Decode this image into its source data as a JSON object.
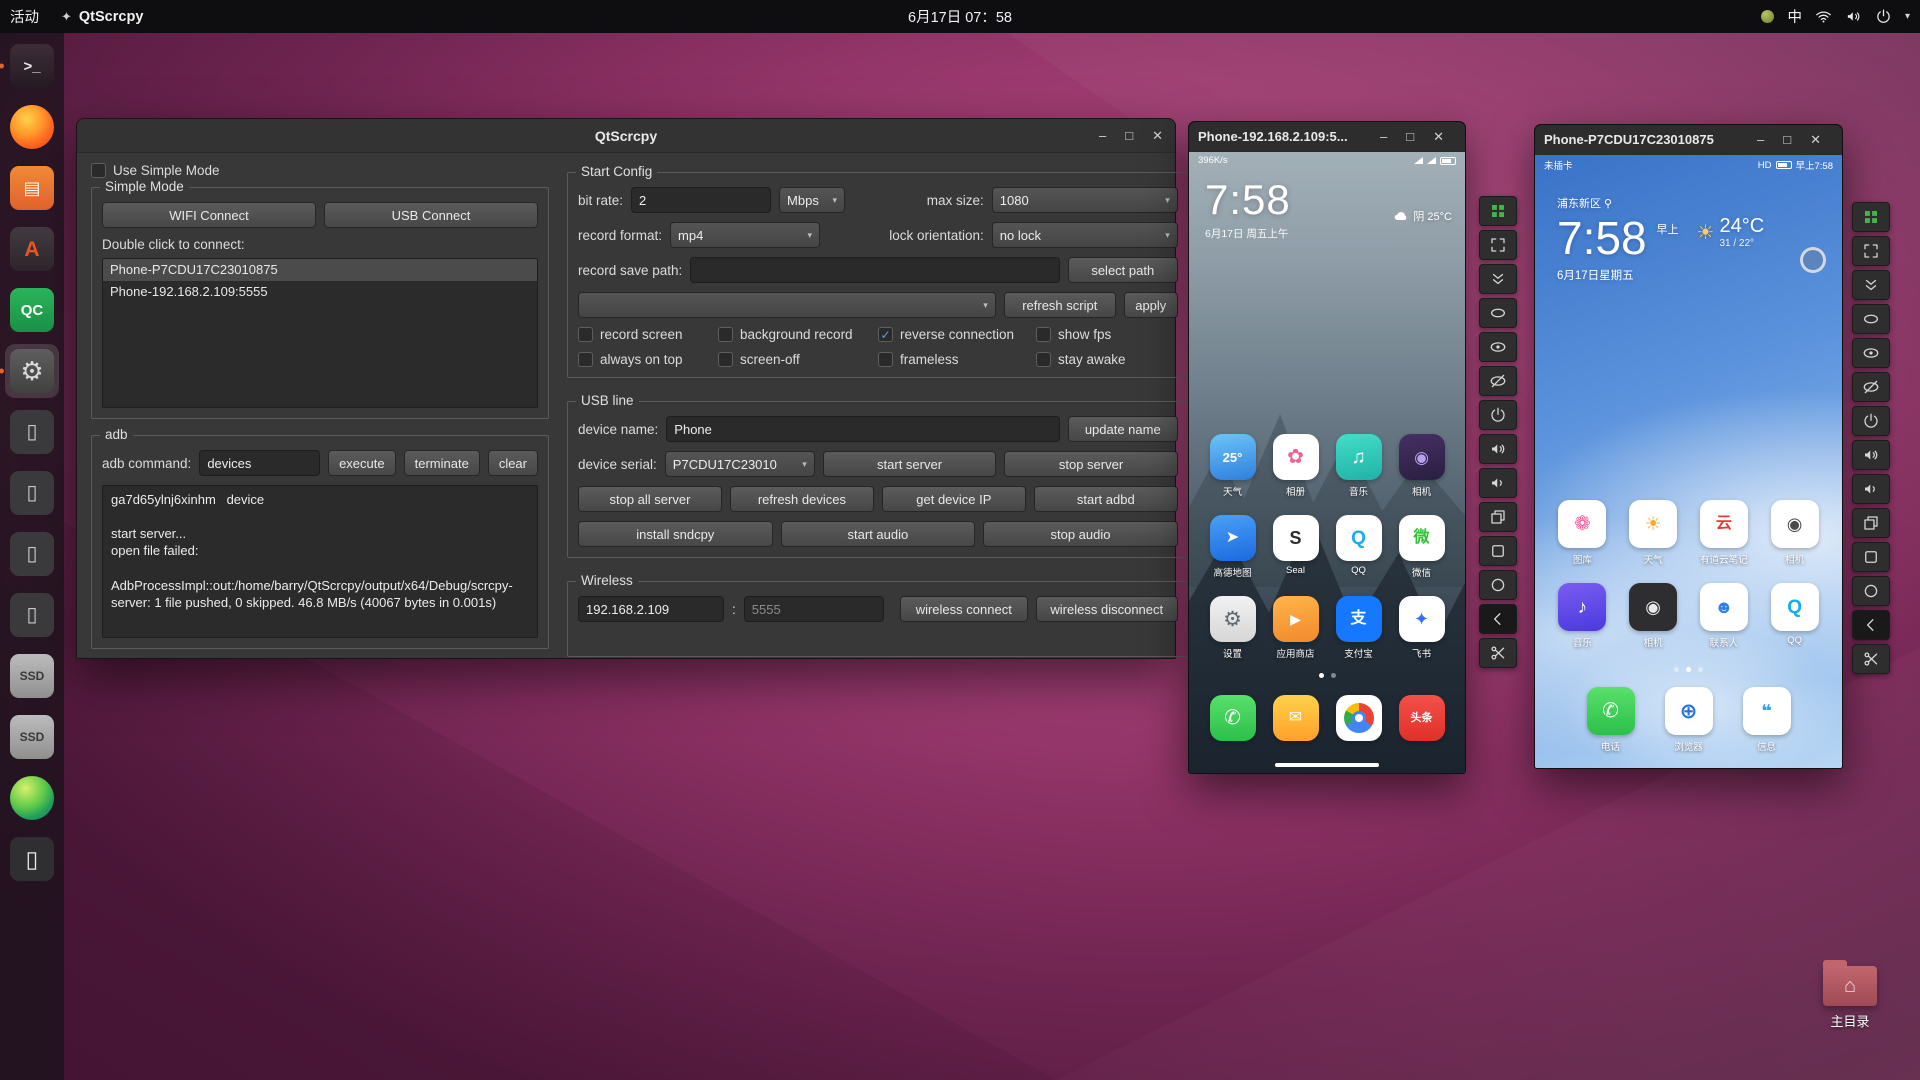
{
  "colors": {
    "accent_check": "#59a0e8",
    "toolbar_screenshot_green": "#44b549",
    "desktop_magenta": "#a84278",
    "running_dot_orange": "#e0622d"
  },
  "topbar": {
    "activities": "活动",
    "app_name": "QtScrcpy",
    "clock": "6月17日 07：58",
    "input_method": "中"
  },
  "dock": {
    "items": [
      {
        "name": "terminal",
        "glyph": ">_",
        "bg": "linear-gradient(#3d2d38,#241a22)",
        "fg": "#e8e6e8",
        "size": 15,
        "running": true
      },
      {
        "name": "firefox",
        "glyph": "",
        "bg": "radial-gradient(circle at 38% 32%, #ffd24a 0%, #ff9a2a 38%, #ff6a1f 62%, #e0431c 100%)",
        "shape": "circle"
      },
      {
        "name": "files",
        "glyph": "▤",
        "bg": "linear-gradient(#f08a38,#e0622a)",
        "fg": "#fff7ee",
        "size": 18
      },
      {
        "name": "ubuntu-software",
        "glyph": "A",
        "bg": "linear-gradient(#423a40,#2c262b)",
        "fg": "#e95420",
        "size": 21
      },
      {
        "name": "qc-app",
        "glyph": "QC",
        "bg": "linear-gradient(#2bb45a,#1a9046)",
        "fg": "#ffffff",
        "size": 15
      },
      {
        "name": "settings-qtscrcpy",
        "glyph": "⚙",
        "bg": "linear-gradient(#5e5e5e,#414141)",
        "fg": "#dadada",
        "size": 26,
        "running": true,
        "active": true
      },
      {
        "name": "device-mirror-1",
        "glyph": "▯",
        "bg": "#3a3a3c",
        "fg": "#c9c9c9",
        "size": 20
      },
      {
        "name": "device-mirror-2",
        "glyph": "▯",
        "bg": "#3a3a3c",
        "fg": "#c9c9c9",
        "size": 20
      },
      {
        "name": "device-mirror-3",
        "glyph": "▯",
        "bg": "#3a3a3c",
        "fg": "#c9c9c9",
        "size": 20
      },
      {
        "name": "device-mirror-4",
        "glyph": "▯",
        "bg": "#3a3a3c",
        "fg": "#c9c9c9",
        "size": 20
      },
      {
        "name": "ssd-drive-1",
        "glyph": "SSD",
        "bg": "linear-gradient(#bcbcbc,#8f8f8f)",
        "fg": "#3a3a3a",
        "size": 12
      },
      {
        "name": "ssd-drive-2",
        "glyph": "SSD",
        "bg": "linear-gradient(#bcbcbc,#8f8f8f)",
        "fg": "#3a3a3a",
        "size": 12
      },
      {
        "name": "green-sphere-app",
        "glyph": "",
        "bg": "radial-gradient(circle at 35% 28%, #d8f06a 0%, #5fc94a 45%, #1f9e5a 70%, #147a86 100%)",
        "shape": "circle"
      },
      {
        "name": "phone-device",
        "glyph": "▯",
        "bg": "#2f2f31",
        "fg": "#e9e9e9",
        "size": 23
      },
      {
        "name": "show-applications",
        "kind": "grid",
        "bg": "transparent"
      }
    ]
  },
  "main": {
    "title": "QtScrcpy",
    "window_buttons": {
      "minimize": "–",
      "maximize": "□",
      "close": "✕"
    },
    "simple": {
      "use_simple_mode": "Use Simple Mode",
      "group_title": "Simple Mode",
      "wifi_connect": "WIFI Connect",
      "usb_connect": "USB Connect",
      "hint": "Double click to connect:",
      "devices": [
        "Phone-P7CDU17C23010875",
        "Phone-192.168.2.109:5555"
      ],
      "selected_index": 0
    },
    "adb": {
      "group_title": "adb",
      "command_label": "adb command:",
      "command_value": "devices",
      "execute": "execute",
      "terminate": "terminate",
      "clear": "clear",
      "log": "ga7d65ylnj6xinhm\tdevice\n\nstart server...\nopen file failed:\n\nAdbProcessImpl::out:/home/barry/QtScrcpy/output/x64/Debug/scrcpy-server: 1 file pushed, 0 skipped. 46.8 MB/s (40067 bytes in 0.001s)"
    },
    "start_config": {
      "title": "Start Config",
      "bit_rate_label": "bit rate:",
      "bit_rate_value": "2",
      "bit_rate_unit": "Mbps",
      "max_size_label": "max size:",
      "max_size_value": "1080",
      "record_format_label": "record format:",
      "record_format_value": "mp4",
      "lock_orientation_label": "lock orientation:",
      "lock_orientation_value": "no lock",
      "record_save_path_label": "record save path:",
      "record_save_path_value": "",
      "select_path": "select path",
      "script_value": "",
      "refresh_script": "refresh script",
      "apply": "apply",
      "checkboxes": [
        {
          "label": "record screen",
          "checked": false
        },
        {
          "label": "background record",
          "checked": false
        },
        {
          "label": "reverse connection",
          "checked": true
        },
        {
          "label": "show fps",
          "checked": false
        },
        {
          "label": "always on top",
          "checked": false
        },
        {
          "label": "screen-off",
          "checked": false
        },
        {
          "label": "frameless",
          "checked": false
        },
        {
          "label": "stay awake",
          "checked": false
        }
      ]
    },
    "usb": {
      "title": "USB line",
      "device_name_label": "device name:",
      "device_name_value": "Phone",
      "update_name": "update name",
      "device_serial_label": "device serial:",
      "device_serial_value": "P7CDU17C23010",
      "buttons_row1": [
        "start server",
        "stop server"
      ],
      "buttons_row2": [
        "stop all server",
        "refresh devices",
        "get device IP",
        "start adbd"
      ],
      "buttons_row3": [
        "install sndcpy",
        "start audio",
        "stop audio"
      ]
    },
    "wireless": {
      "title": "Wireless",
      "ip_value": "192.168.2.109",
      "colon": ":",
      "port_placeholder": "5555",
      "connect": "wireless connect",
      "disconnect": "wireless disconnect"
    }
  },
  "phone1": {
    "window_title": "Phone-192.168.2.109:5...",
    "status_left": "396K/s",
    "clock": "7:58",
    "date": "6月17日 周五上午",
    "weather": "阴 25°C",
    "apps": [
      {
        "label": "天气",
        "glyph": "25°",
        "bg": "linear-gradient(170deg,#6cc4f5,#2f7fe0)",
        "fg": "#fff",
        "gsize": 13
      },
      {
        "label": "相册",
        "glyph": "✿",
        "bg": "#ffffff",
        "fg": "#f06292",
        "gsize": 20
      },
      {
        "label": "音乐",
        "glyph": "♫",
        "bg": "linear-gradient(170deg,#45ddc8,#1fb3a8)",
        "fg": "#ffffff",
        "gsize": 19
      },
      {
        "label": "相机",
        "glyph": "◉",
        "bg": "linear-gradient(170deg,#453062,#2b1e42)",
        "fg": "#b9a0ef",
        "gsize": 17
      },
      {
        "label": "高德地图",
        "glyph": "➤",
        "bg": "linear-gradient(170deg,#4aa0f5,#1b6ae0)",
        "fg": "#ffffff",
        "gsize": 16
      },
      {
        "label": "Seal",
        "glyph": "S",
        "bg": "#ffffff",
        "fg": "#2b2b2b",
        "gsize": 18
      },
      {
        "label": "QQ",
        "glyph": "Q",
        "bg": "#ffffff",
        "fg": "#10aef0",
        "gsize": 19
      },
      {
        "label": "微信",
        "glyph": "微",
        "bg": "#ffffff",
        "fg": "#2fc433",
        "gsize": 16
      },
      {
        "label": "设置",
        "glyph": "⚙",
        "bg": "linear-gradient(#f2f2f2,#d6d6d6)",
        "fg": "#5b6a75",
        "gsize": 21
      },
      {
        "label": "应用商店",
        "glyph": "▶",
        "bg": "linear-gradient(170deg,#ffb54a,#f2892a)",
        "fg": "#ffffff",
        "gsize": 14
      },
      {
        "label": "支付宝",
        "glyph": "支",
        "bg": "#1677ff",
        "fg": "#ffffff",
        "gsize": 16
      },
      {
        "label": "飞书",
        "glyph": "✦",
        "bg": "#ffffff",
        "fg": "#3370ff",
        "gsize": 18
      }
    ],
    "dock_apps": [
      {
        "name": "phone",
        "glyph": "✆",
        "bg": "linear-gradient(#58e06a,#2cc04a)",
        "fg": "#fff",
        "gsize": 20
      },
      {
        "name": "messages",
        "glyph": "✉",
        "bg": "linear-gradient(#ffd24a,#ffa02a)",
        "fg": "#fff",
        "gsize": 16
      },
      {
        "name": "chrome",
        "chrome": true,
        "bg": "#ffffff"
      },
      {
        "name": "toutiao",
        "glyph": "头条",
        "bg": "linear-gradient(#f5504a,#e03028)",
        "fg": "#fff",
        "gsize": 11
      }
    ],
    "page_dots": [
      true,
      false
    ]
  },
  "phone2": {
    "window_title": "Phone-P7CDU17C23010875",
    "status_left": "未插卡",
    "status_hd": "HD",
    "status_time": "早上7:58",
    "city": "浦东新区",
    "clock": "7:58",
    "period": "早上",
    "temp": "24°C",
    "hi_lo": "31 / 22°",
    "date": "6月17日星期五",
    "apps": [
      {
        "label": "图库",
        "glyph": "❁",
        "bg": "#ffffff",
        "fg": "#ef5da0",
        "gsize": 20
      },
      {
        "label": "天气",
        "glyph": "☀",
        "bg": "#ffffff",
        "fg": "#ffa726",
        "gsize": 19
      },
      {
        "label": "有道云笔记",
        "glyph": "云",
        "bg": "#ffffff",
        "fg": "#e53935",
        "gsize": 16
      },
      {
        "label": "相机",
        "glyph": "◉",
        "bg": "#ffffff",
        "fg": "#4a4a4a",
        "gsize": 18
      },
      {
        "label": "音乐",
        "glyph": "♪",
        "bg": "linear-gradient(170deg,#7a5cf0,#4a3ae0)",
        "fg": "#ffffff",
        "gsize": 19
      },
      {
        "label": "相机",
        "glyph": "◉",
        "bg": "#2e2e30",
        "fg": "#e8e8e8",
        "gsize": 18
      },
      {
        "label": "联系人",
        "glyph": "☻",
        "bg": "#ffffff",
        "fg": "#2f7fe8",
        "gsize": 18
      },
      {
        "label": "QQ",
        "glyph": "Q",
        "bg": "#ffffff",
        "fg": "#10aef0",
        "gsize": 19
      }
    ],
    "dock_apps": [
      {
        "label": "电话",
        "glyph": "✆",
        "bg": "linear-gradient(#58e06a,#2cc04a)",
        "fg": "#fff",
        "gsize": 20
      },
      {
        "label": "浏览器",
        "glyph": "⊕",
        "bg": "#ffffff",
        "fg": "#1f6fe8",
        "gsize": 21
      },
      {
        "label": "信息",
        "glyph": "❝",
        "bg": "#ffffff",
        "fg": "#2f9ff0",
        "gsize": 18
      }
    ],
    "page_dots": [
      false,
      true,
      false
    ]
  },
  "phone_toolbar": [
    {
      "name": "screenshot-icon",
      "icon": "grid",
      "color": "#44b549"
    },
    {
      "name": "fullscreen-icon",
      "icon": "expand"
    },
    {
      "name": "expand-notification-icon",
      "icon": "chevrons-down"
    },
    {
      "name": "touch-icon",
      "icon": "ellipse"
    },
    {
      "name": "screen-show-icon",
      "icon": "eye"
    },
    {
      "name": "screen-off-icon",
      "icon": "eye-off"
    },
    {
      "name": "power-icon",
      "icon": "power"
    },
    {
      "name": "volume-up-icon",
      "icon": "volume-up"
    },
    {
      "name": "volume-down-icon",
      "icon": "volume-down"
    },
    {
      "name": "app-switch-icon",
      "icon": "app-switch"
    },
    {
      "name": "home-icon",
      "icon": "square"
    },
    {
      "name": "back-icon",
      "icon": "circle"
    },
    {
      "name": "collapse-icon",
      "icon": "chevron-left",
      "dark": true
    },
    {
      "name": "crop-screenshot-icon",
      "icon": "scissors"
    }
  ],
  "desktop": {
    "home_label": "主目录"
  }
}
